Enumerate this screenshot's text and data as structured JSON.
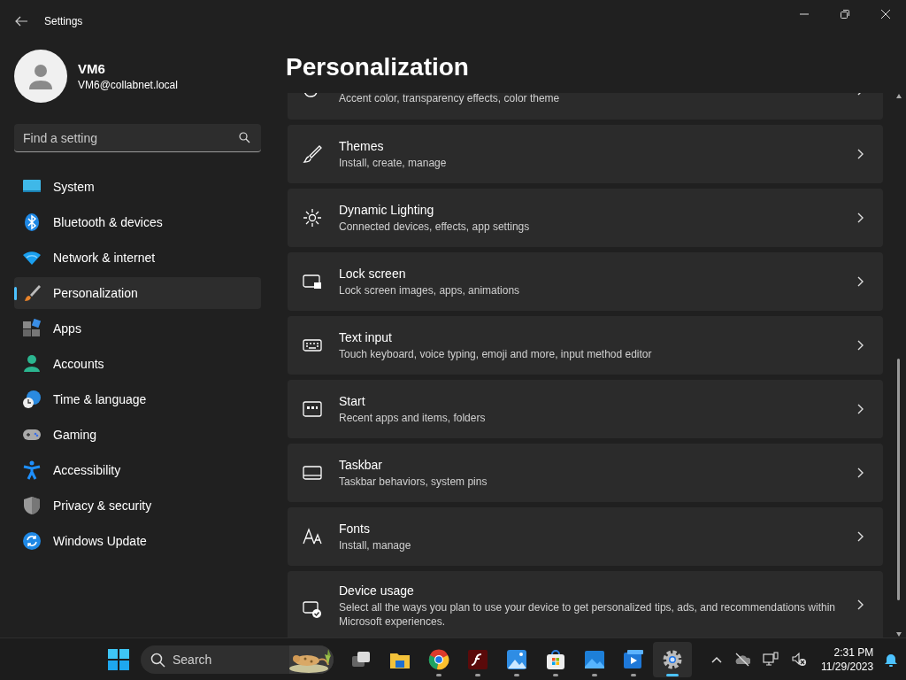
{
  "window": {
    "title": "Settings"
  },
  "profile": {
    "name": "VM6",
    "email": "VM6@collabnet.local"
  },
  "search": {
    "placeholder": "Find a setting"
  },
  "sidebar": {
    "items": [
      {
        "label": "System",
        "selected": false
      },
      {
        "label": "Bluetooth & devices",
        "selected": false
      },
      {
        "label": "Network & internet",
        "selected": false
      },
      {
        "label": "Personalization",
        "selected": true
      },
      {
        "label": "Apps",
        "selected": false
      },
      {
        "label": "Accounts",
        "selected": false
      },
      {
        "label": "Time & language",
        "selected": false
      },
      {
        "label": "Gaming",
        "selected": false
      },
      {
        "label": "Accessibility",
        "selected": false
      },
      {
        "label": "Privacy & security",
        "selected": false
      },
      {
        "label": "Windows Update",
        "selected": false
      }
    ]
  },
  "page": {
    "title": "Personalization",
    "cards": [
      {
        "description": "Accent color, transparency effects, color theme"
      },
      {
        "title": "Themes",
        "description": "Install, create, manage"
      },
      {
        "title": "Dynamic Lighting",
        "description": "Connected devices, effects, app settings"
      },
      {
        "title": "Lock screen",
        "description": "Lock screen images, apps, animations"
      },
      {
        "title": "Text input",
        "description": "Touch keyboard, voice typing, emoji and more, input method editor"
      },
      {
        "title": "Start",
        "description": "Recent apps and items, folders"
      },
      {
        "title": "Taskbar",
        "description": "Taskbar behaviors, system pins"
      },
      {
        "title": "Fonts",
        "description": "Install, manage"
      },
      {
        "title": "Device usage",
        "description": "Select all the ways you plan to use your device to get personalized tips, ads, and recommendations within Microsoft experiences."
      }
    ]
  },
  "taskbar": {
    "search": {
      "placeholder": "Search"
    },
    "apps": [
      {
        "running": false,
        "active": false
      },
      {
        "running": false,
        "active": false
      },
      {
        "running": true,
        "active": false
      },
      {
        "running": true,
        "active": false
      },
      {
        "running": true,
        "active": false
      },
      {
        "running": true,
        "active": false
      },
      {
        "running": true,
        "active": false
      },
      {
        "running": true,
        "active": false
      },
      {
        "running": true,
        "active": true
      }
    ],
    "time": "2:31 PM",
    "date": "11/29/2023"
  }
}
